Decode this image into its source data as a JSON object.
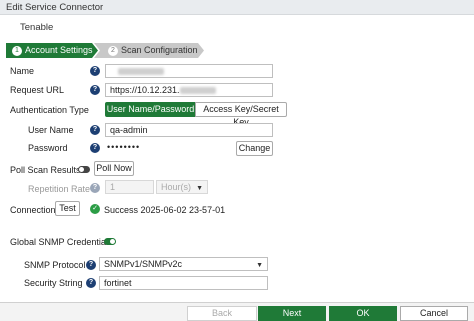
{
  "window": {
    "title": "Edit Service Connector"
  },
  "connector": {
    "name": "Tenable"
  },
  "steps": [
    {
      "number": "1",
      "label": "Account Settings"
    },
    {
      "number": "2",
      "label": "Scan Configuration"
    }
  ],
  "help_glyph": "?",
  "form": {
    "name_label": "Name",
    "request_url_label": "Request URL",
    "request_url_value": "https://10.12.231.",
    "auth_type_label": "Authentication Type",
    "auth_options": [
      "User Name/Password",
      "Access Key/Secret Key"
    ],
    "auth_selected": "User Name/Password",
    "username_label": "User Name",
    "username_value": "qa-admin",
    "password_label": "Password",
    "password_value": "••••••••",
    "change_label": "Change",
    "poll_label": "Poll Scan Results",
    "poll_now_label": "Poll Now",
    "repetition_label": "Repetition Rate",
    "repetition_value": "1",
    "repetition_unit": "Hour(s)",
    "connection_label": "Connection",
    "test_label": "Test",
    "success_icon": "✓",
    "connection_status": "Success 2025-06-02 23-57-01",
    "snmp_label": "Global SNMP Credential",
    "snmp_protocol_label": "SNMP Protocol",
    "snmp_protocol_value": "SNMPv1/SNMPv2c",
    "security_string_label": "Security String",
    "security_string_value": "fortinet"
  },
  "footer": {
    "back": "Back",
    "next": "Next",
    "ok": "OK",
    "cancel": "Cancel"
  },
  "colors": {
    "accent": "#1f7a37",
    "help": "#1d3f73",
    "success": "#2c9d46"
  }
}
